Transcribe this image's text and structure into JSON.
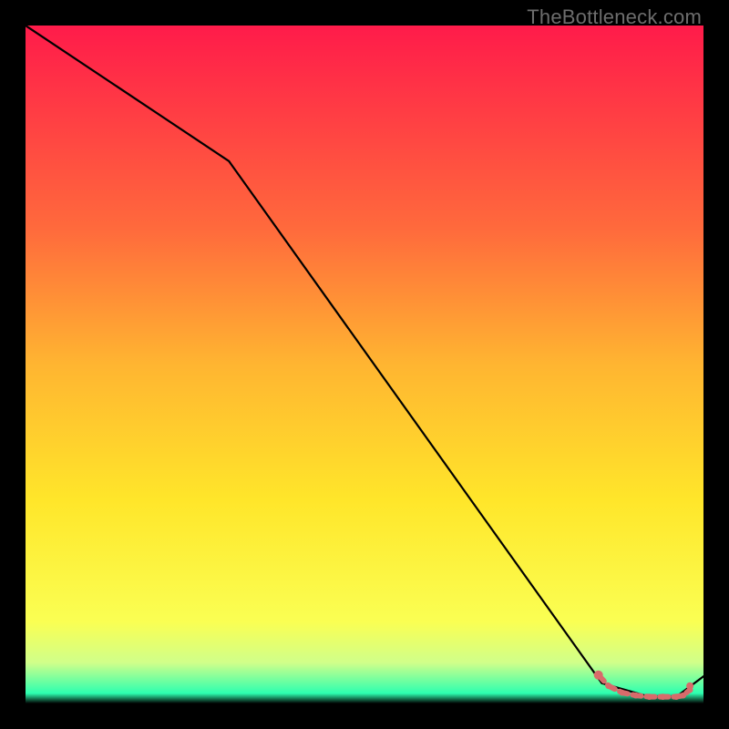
{
  "watermark": "TheBottleneck.com",
  "chart_data": {
    "type": "line",
    "title": "",
    "xlabel": "",
    "ylabel": "",
    "xlim": [
      0,
      100
    ],
    "ylim": [
      0,
      100
    ],
    "grid": false,
    "series": [
      {
        "name": "main-curve",
        "color": "#000000",
        "x": [
          0,
          30,
          85,
          92,
          96,
          100
        ],
        "y": [
          100,
          80,
          3,
          1,
          1,
          4
        ]
      }
    ],
    "markers": {
      "name": "highlighted-segment",
      "color": "#d86b6b",
      "x": [
        84.5,
        86,
        88,
        90,
        92,
        94,
        96,
        97,
        98
      ],
      "y": [
        4.2,
        2.6,
        1.6,
        1.2,
        1.0,
        1.0,
        1.0,
        1.2,
        2.0
      ]
    },
    "background_gradient": {
      "stops": [
        {
          "y": 100,
          "color": "#ff1b4a"
        },
        {
          "y": 70,
          "color": "#ff6a3c"
        },
        {
          "y": 50,
          "color": "#ffb531"
        },
        {
          "y": 30,
          "color": "#ffe62a"
        },
        {
          "y": 12,
          "color": "#faff53"
        },
        {
          "y": 6,
          "color": "#d0ff8a"
        },
        {
          "y": 1.5,
          "color": "#2dffb0"
        },
        {
          "y": 0,
          "color": "#000000"
        }
      ]
    }
  }
}
